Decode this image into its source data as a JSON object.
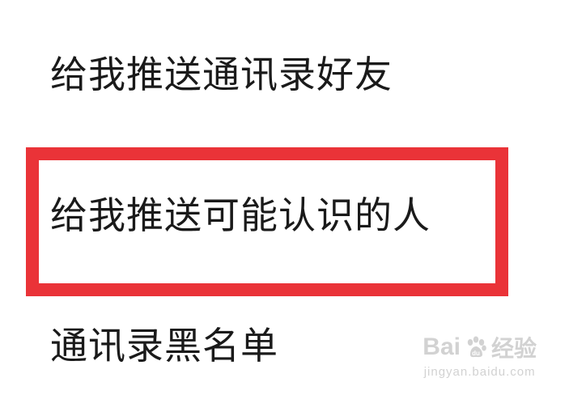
{
  "settings": {
    "items": [
      {
        "label": "给我推送通讯录好友"
      },
      {
        "label": "给我推送可能认识的人",
        "highlighted": true
      },
      {
        "label": "通讯录黑名单"
      }
    ]
  },
  "highlight": {
    "color": "#ea3338"
  },
  "watermark": {
    "logo_prefix": "Bai",
    "logo_suffix": "经验",
    "url": "jingyan.baidu.com"
  }
}
